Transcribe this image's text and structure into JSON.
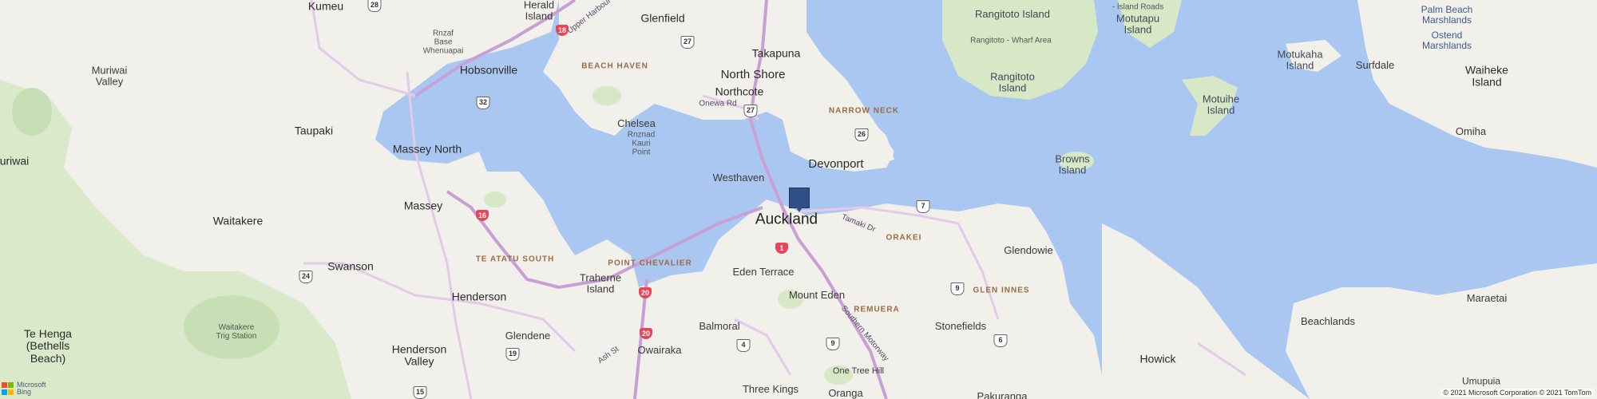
{
  "map": {
    "colors": {
      "water": "#a9c7f0",
      "land": "#f2f0ea",
      "park": "#d6e8c6",
      "motorway": "#c9a0d6",
      "road": "#e3cbe8",
      "pin": "#2e5086",
      "highway_shield": "#e8445a"
    },
    "city": "Auckland",
    "towns": {
      "kumeu": "Kumeu",
      "herald_island": "Herald\nIsland",
      "glenfield": "Glenfield",
      "takapuna": "Takapuna",
      "rnzaf": "Rnzaf\nBase\nWhenuapai",
      "hobsonville": "Hobsonville",
      "north_shore": "North Shore",
      "northcote": "Northcote",
      "muriwai_valley": "Muriwai\nValley",
      "taupaki": "Taupaki",
      "chelsea": "Chelsea",
      "rnznad": "Rnznad\nKauri\nPoint",
      "massey_north": "Massey North",
      "devonport": "Devonport",
      "muriwai": "uriwai",
      "westhaven": "Westhaven",
      "massey": "Massey",
      "waitakere": "Waitakere",
      "glendowie": "Glendowie",
      "traherne": "Traherne\nIsland",
      "swanson": "Swanson",
      "eden_terrace": "Eden Terrace",
      "henderson": "Henderson",
      "mount_eden": "Mount Eden",
      "te_henga": "Te Henga\n(Bethells\nBeach)",
      "waitakere_trig": "Waitakere\nTrig Station",
      "stonefields": "Stonefields",
      "glendene": "Glendene",
      "balmoral": "Balmoral",
      "henderson_valley": "Henderson\nValley",
      "owairaka": "Owairaka",
      "one_tree_hill": "One Tree Hill",
      "three_kings": "Three Kings",
      "onehunga": "Oranga",
      "pakuranga": "Pakuranga",
      "howick": "Howick",
      "beachlands": "Beachlands",
      "maraetai": "Maraetai",
      "umupuia": "Umupuia"
    },
    "islands": {
      "rangitoto_island_top": "Rangitoto Island",
      "rangitoto_wharf": "Rangitoto - Wharf Area",
      "rangitoto_island": "Rangitoto\nIsland",
      "motutapu_roads": "- Island Roads",
      "motutapu": "Motutapu\nIsland",
      "browns": "Browns\nIsland",
      "motuihe": "Motuihe\nIsland",
      "motukaha": "Motukaha\nIsland",
      "palm_beach": "Palm Beach\nMarshlands",
      "ostend": "Ostend\nMarshlands",
      "surfdale": "Surfdale",
      "waiheke": "Waiheke\nIsland",
      "omiha": "Omiha"
    },
    "suburbs": {
      "beach_haven": "BEACH HAVEN",
      "narrow_neck": "NARROW NECK",
      "te_atatu_south": "TE ATATU SOUTH",
      "point_chevalier": "POINT CHEVALIER",
      "orakei": "ORAKEI",
      "glen_innes": "GLEN INNES",
      "remuera": "REMUERA"
    },
    "roads": {
      "onewa": "Onewa Rd",
      "tamaki": "Tamaki Dr",
      "southern": "Southern Motorway",
      "ash": "Ash St",
      "upper": "Upper Harbour"
    },
    "shields": {
      "s28": "28",
      "s18": "18",
      "s27a": "27",
      "s32": "32",
      "s27b": "27",
      "s26": "26",
      "s7": "7",
      "s16": "16",
      "s1": "1",
      "s24": "24",
      "s20a": "20",
      "s20b": "20",
      "s9a": "9",
      "s6": "6",
      "s4": "4",
      "s9b": "9",
      "s19": "19",
      "s15": "15"
    },
    "logo": {
      "line1": "Microsoft",
      "line2": "Bing",
      "colors": [
        "#f25022",
        "#7fba00",
        "#00a4ef",
        "#ffb900"
      ]
    },
    "copyright": "© 2021 Microsoft Corporation © 2021 TomTom"
  }
}
